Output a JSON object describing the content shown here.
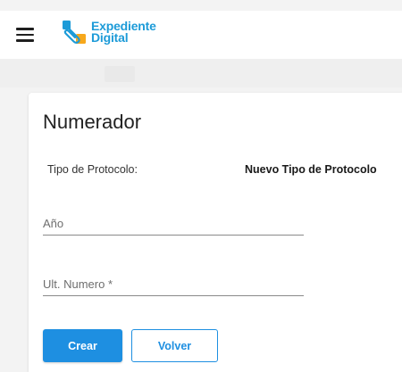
{
  "header": {
    "brand_line1": "Expediente",
    "brand_line2": "Digital",
    "menu_icon": "hamburger-menu-icon",
    "logo_icon": "clip-logo-icon"
  },
  "form": {
    "title": "Numerador",
    "protocol_label": "Tipo de Protocolo:",
    "protocol_value": "Nuevo Tipo de Protocolo",
    "anio": {
      "placeholder": "Año",
      "value": ""
    },
    "ult_numero": {
      "placeholder": "Ult. Numero *",
      "value": ""
    },
    "create_label": "Crear",
    "back_label": "Volver"
  },
  "colors": {
    "brand_blue": "#1d9bd8",
    "brand_orange": "#f7a81b",
    "primary_button": "#1e8fe1",
    "background": "#f3f3f3"
  }
}
